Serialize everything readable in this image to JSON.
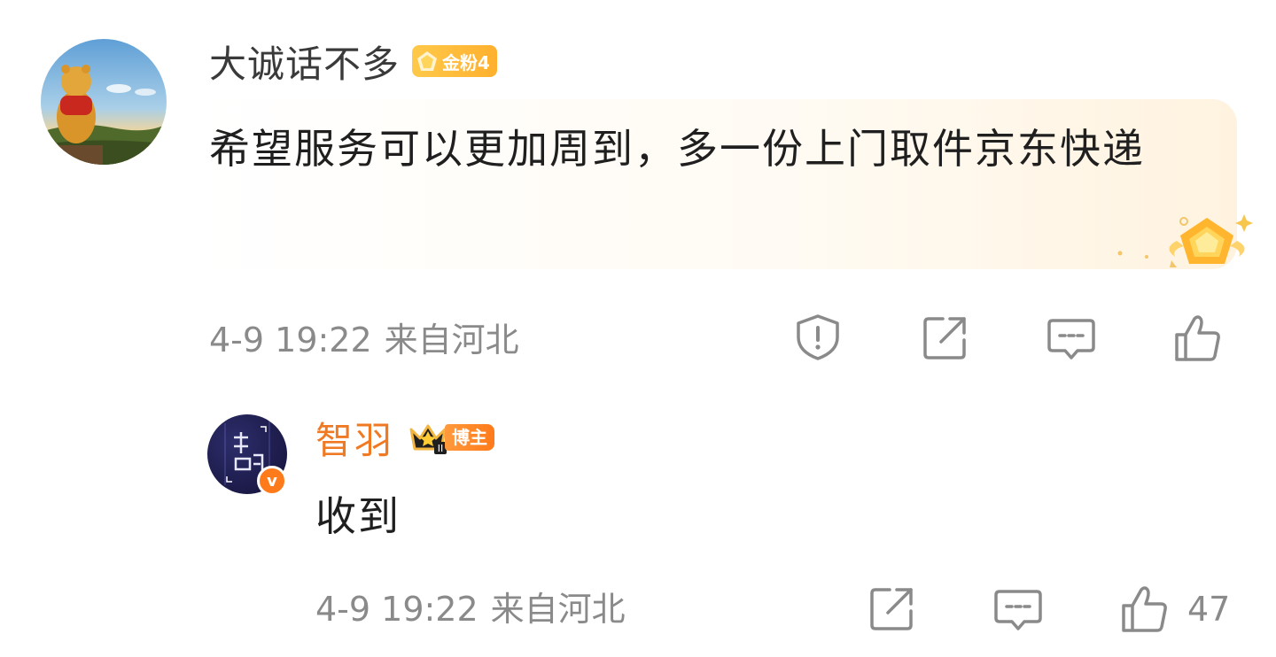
{
  "comment": {
    "author": "大诚话不多",
    "fan_badge_label": "金粉4",
    "text": "希望服务可以更加周到，多一份上门取件京东快递",
    "time": "4-9 19:22",
    "location": "来自河北",
    "actions": [
      "report-icon",
      "share-icon",
      "reply-icon",
      "like-icon"
    ]
  },
  "reply": {
    "author": "智羽",
    "badge_label": "博主",
    "text": "收到",
    "time": "4-9 19:22",
    "location": "来自河北",
    "like_count": "47",
    "actions": [
      "share-icon",
      "reply-icon",
      "like-icon"
    ]
  },
  "colors": {
    "reply_author": "#f07a23",
    "meta_gray": "#8a8a8a",
    "badge_gold": "#ffb02e",
    "verified_orange": "#ff7a1a"
  }
}
